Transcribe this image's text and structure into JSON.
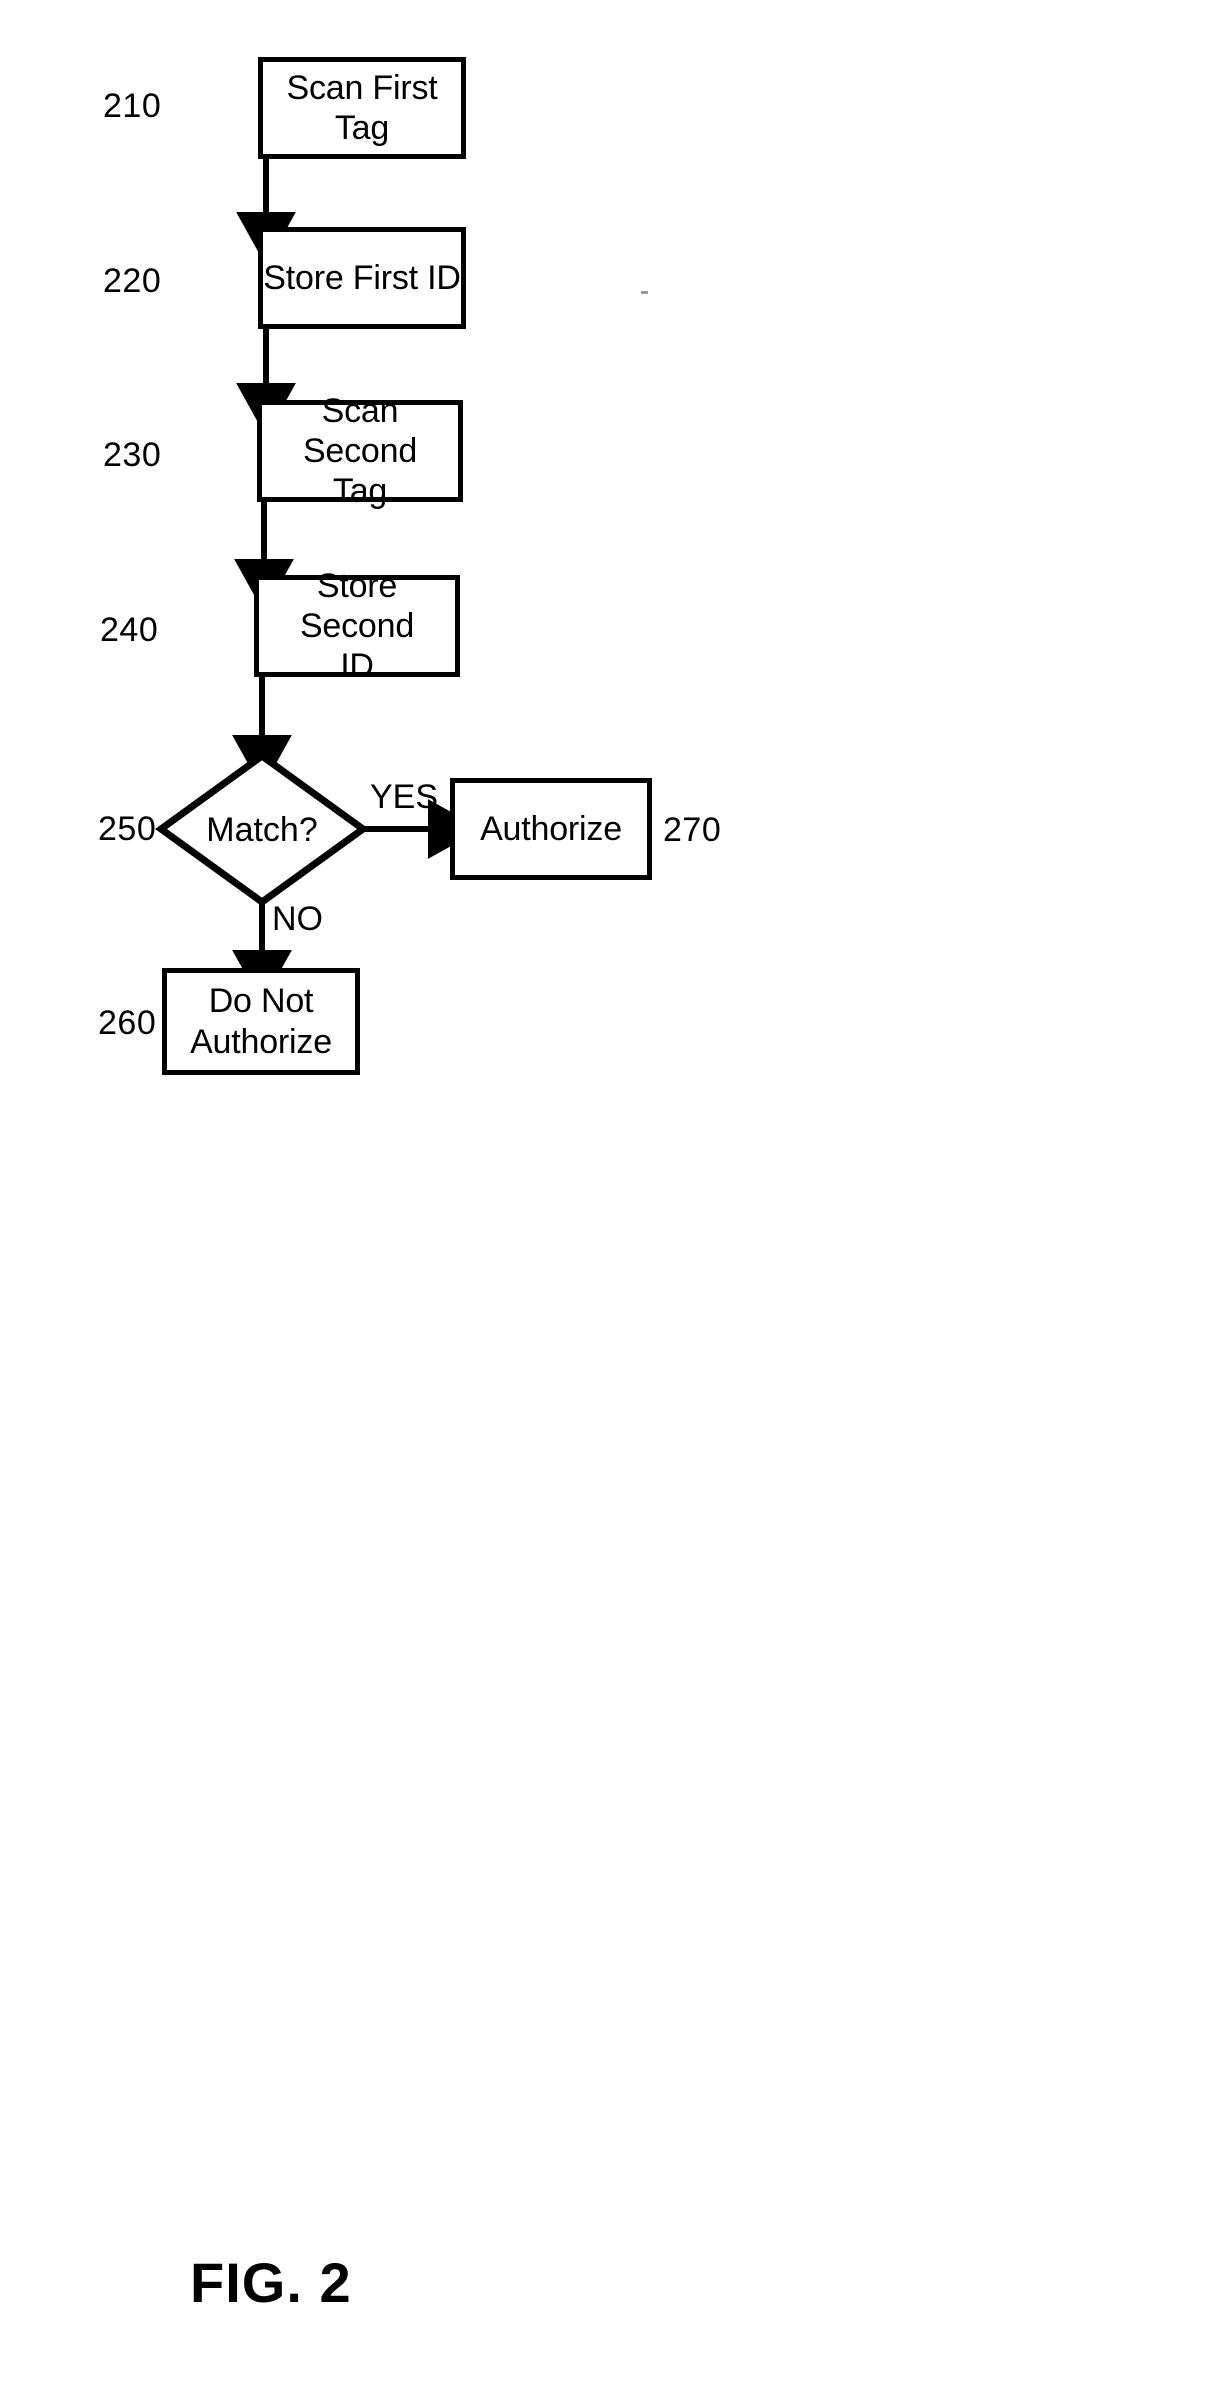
{
  "figure": {
    "caption": "FIG. 2",
    "type": "patent-flowchart"
  },
  "nodes": [
    {
      "id": "scan-first-tag",
      "ref": "210",
      "label": "Scan First\nTag",
      "shape": "rect"
    },
    {
      "id": "store-first-id",
      "ref": "220",
      "label": "Store First ID",
      "shape": "rect"
    },
    {
      "id": "scan-second-tag",
      "ref": "230",
      "label": "Scan Second\nTag",
      "shape": "rect"
    },
    {
      "id": "store-second-id",
      "ref": "240",
      "label": "Store Second\nID",
      "shape": "rect"
    },
    {
      "id": "match-decision",
      "ref": "250",
      "label": "Match?",
      "shape": "diamond"
    },
    {
      "id": "do-not-authorize",
      "ref": "260",
      "label": "Do Not\nAuthorize",
      "shape": "rect"
    },
    {
      "id": "authorize",
      "ref": "270",
      "label": "Authorize",
      "shape": "rect"
    }
  ],
  "edges": [
    {
      "from": "scan-first-tag",
      "to": "store-first-id",
      "label": ""
    },
    {
      "from": "store-first-id",
      "to": "scan-second-tag",
      "label": ""
    },
    {
      "from": "scan-second-tag",
      "to": "store-second-id",
      "label": ""
    },
    {
      "from": "store-second-id",
      "to": "match-decision",
      "label": ""
    },
    {
      "from": "match-decision",
      "to": "authorize",
      "label": "YES"
    },
    {
      "from": "match-decision",
      "to": "do-not-authorize",
      "label": "NO"
    }
  ],
  "labels": {
    "ref_210": "210",
    "ref_220": "220",
    "ref_230": "230",
    "ref_240": "240",
    "ref_250": "250",
    "ref_260": "260",
    "ref_270": "270",
    "yes": "YES",
    "no": "NO",
    "node_210": "Scan First\nTag",
    "node_220": "Store First ID",
    "node_230": "Scan Second\nTag",
    "node_240": "Store Second\nID",
    "node_250": "Match?",
    "node_260": "Do Not\nAuthorize",
    "node_270": "Authorize"
  },
  "colors": {
    "stroke": "#000000",
    "fill": "#ffffff",
    "text": "#000000"
  }
}
